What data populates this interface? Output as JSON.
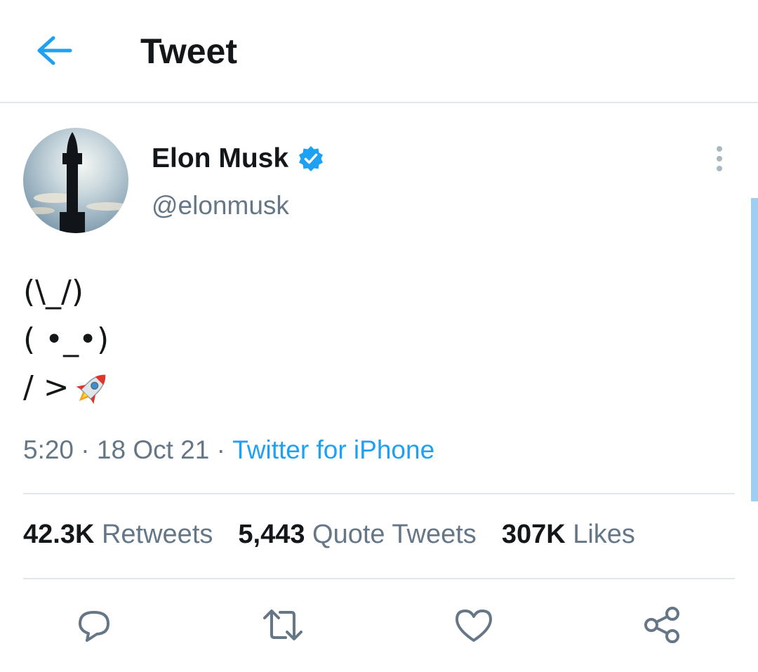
{
  "header": {
    "title": "Tweet",
    "back_icon": "arrow-left-icon"
  },
  "author": {
    "name": "Elon Musk",
    "handle": "@elonmusk",
    "verified": true
  },
  "tweet": {
    "lines": [
      "(\\_/)",
      "( •_•)",
      "/ >"
    ],
    "emoji": "rocket-icon"
  },
  "meta": {
    "time": "5:20",
    "sep1": " · ",
    "date": "18 Oct 21",
    "sep2": " · ",
    "source": "Twitter for iPhone"
  },
  "stats": {
    "retweets": {
      "count": "42.3K",
      "label": "Retweets"
    },
    "quotes": {
      "count": "5,443",
      "label": "Quote Tweets"
    },
    "likes": {
      "count": "307K",
      "label": "Likes"
    }
  },
  "actions": [
    "reply-icon",
    "retweet-icon",
    "like-icon",
    "share-icon"
  ],
  "colors": {
    "accent": "#1da1f2",
    "text": "#14171a",
    "secondary": "#657786",
    "divider": "#e1e8ed"
  }
}
